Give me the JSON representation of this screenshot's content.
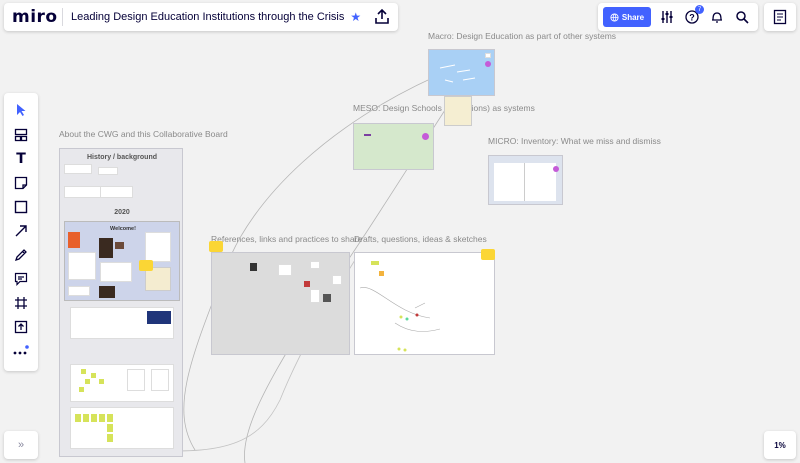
{
  "app": {
    "logo": "miro",
    "board_title": "Leading Design Education Institutions through the Crisis"
  },
  "header": {
    "share_label": "Share",
    "help_badge": "7"
  },
  "zoom": {
    "level": "1%"
  },
  "collapse": {
    "label": "»"
  },
  "toolbar": {
    "tools": [
      {
        "name": "select-tool",
        "icon": "cursor-icon"
      },
      {
        "name": "templates-tool",
        "icon": "templates-icon"
      },
      {
        "name": "text-tool",
        "icon": "text-icon"
      },
      {
        "name": "sticky-note-tool",
        "icon": "sticky-note-icon"
      },
      {
        "name": "shape-tool",
        "icon": "square-icon"
      },
      {
        "name": "connection-line-tool",
        "icon": "arrow-icon"
      },
      {
        "name": "pen-tool",
        "icon": "pen-icon"
      },
      {
        "name": "comment-tool",
        "icon": "comment-icon"
      },
      {
        "name": "frame-tool",
        "icon": "frame-icon"
      },
      {
        "name": "upload-tool",
        "icon": "upload-icon"
      },
      {
        "name": "more-tools",
        "icon": "more-icon"
      }
    ],
    "text_glyph": "T"
  },
  "canvas": {
    "labels": {
      "macro": "Macro: Design Education as part of other systems",
      "meso": "MESO: Design Schools (institutions) as  systems",
      "micro": "MICRO: Inventory: What we miss and dismiss",
      "about": "About the CWG and this Collaborative Board",
      "references": "References, links and practices to share",
      "drafts": "Drafts, questions, ideas & sketches"
    },
    "about_frame": {
      "history_title": "History / background",
      "year": "2020",
      "welcome": "Welcome!"
    }
  },
  "colors": {
    "accent": "#4262ff",
    "sticky": "#fbd635"
  }
}
